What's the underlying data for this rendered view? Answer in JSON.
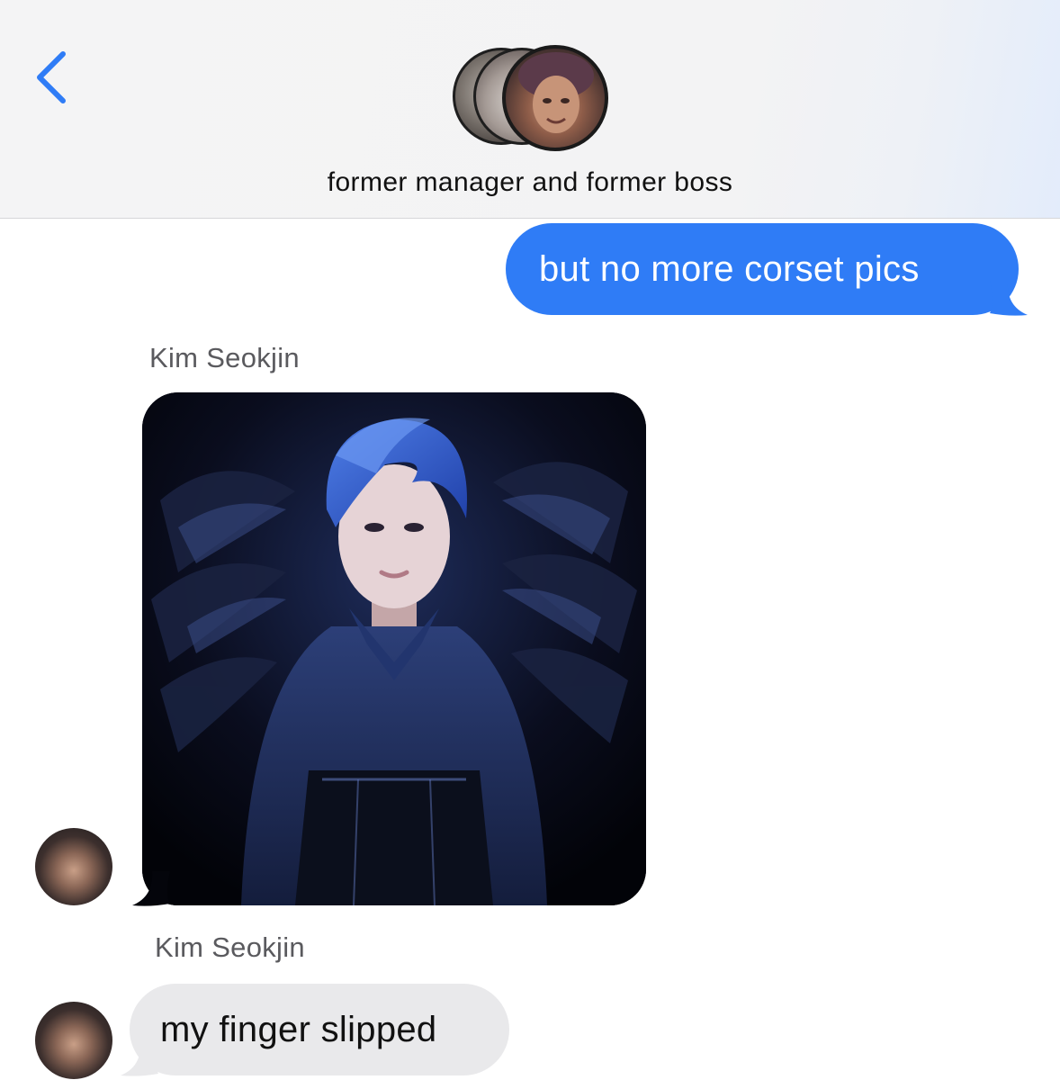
{
  "header": {
    "back_icon": "chevron-left-icon",
    "group_name": "former manager and former boss",
    "accent_color": "#2f7cf6"
  },
  "messages": [
    {
      "type": "sent",
      "text": "but no more corset pics",
      "bubble_color": "#2f7cf6"
    },
    {
      "type": "received-image",
      "sender": "Kim Seokjin"
    },
    {
      "type": "received",
      "sender": "Kim Seokjin",
      "text": "my finger slipped",
      "bubble_color": "#e9e9eb"
    }
  ]
}
